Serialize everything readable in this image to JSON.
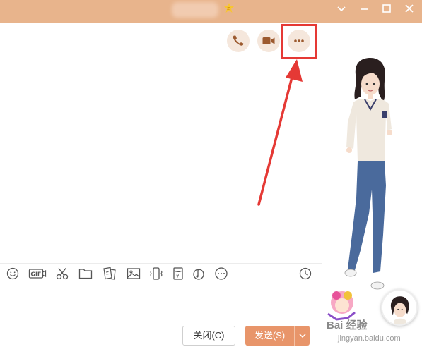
{
  "window": {
    "minimize_icon": "chevron-down-icon",
    "restore_icon": "minimize-icon",
    "maximize_icon": "maximize-icon",
    "close_icon": "close-icon",
    "title_bar_color": "#e8b48c"
  },
  "chat_header_actions": [
    {
      "name": "voice-call",
      "icon": "phone-icon"
    },
    {
      "name": "video-call",
      "icon": "video-camera-icon"
    },
    {
      "name": "more",
      "icon": "more-dots-icon"
    }
  ],
  "toolbar": {
    "icons": [
      "emoji-icon",
      "gif-icon",
      "scissors-icon",
      "folder-icon",
      "ecard-icon",
      "image-icon",
      "shake-icon",
      "red-packet-icon",
      "music-icon",
      "more-icon",
      "history-clock-icon"
    ],
    "gif_label": "GIF",
    "red_packet_label": "¥"
  },
  "buttons": {
    "close_label": "关闭(C)",
    "send_label": "发送(S)"
  },
  "watermark": {
    "logo": "Bai 经验",
    "sub": "jingyan.baidu.com"
  },
  "colors": {
    "accent": "#e8956a",
    "highlight": "#e53935",
    "icon_brown": "#9c5a2f"
  }
}
